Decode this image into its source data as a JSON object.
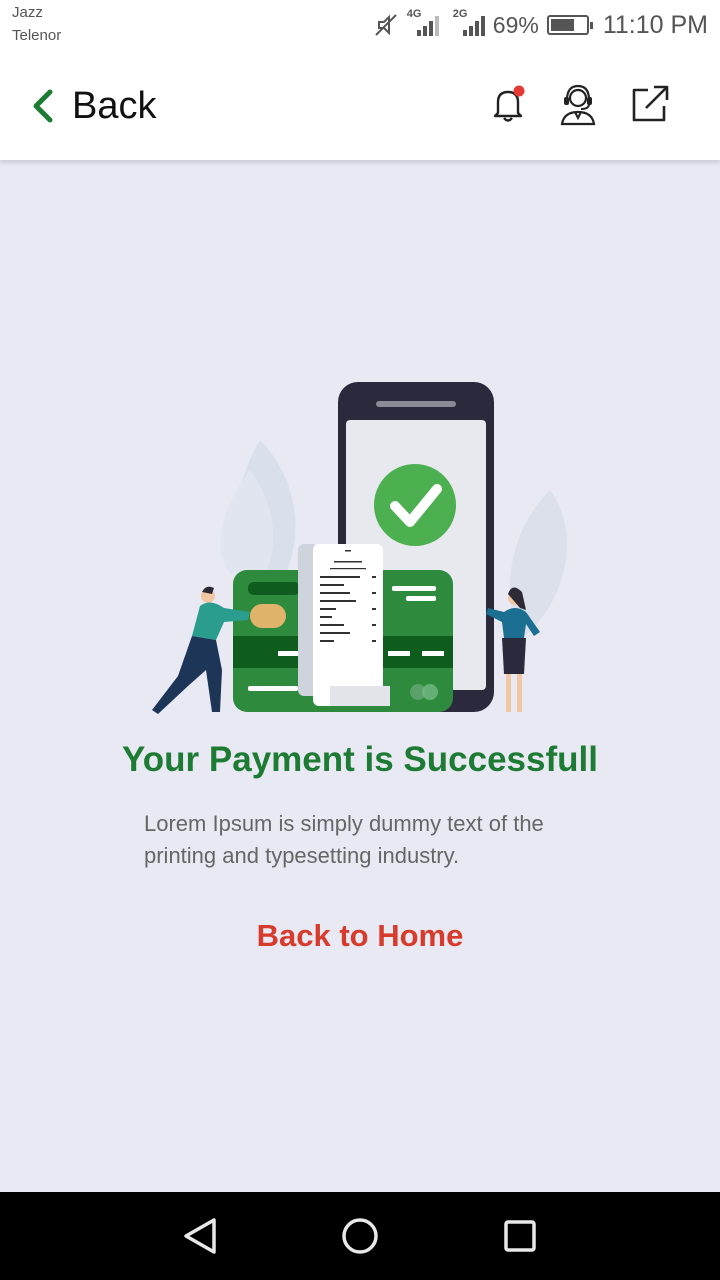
{
  "status_bar": {
    "carrier_1": "Jazz",
    "carrier_2": "Telenor",
    "network_1": "4G",
    "network_2": "2G",
    "battery_percent": "69%",
    "time": "11:10 PM",
    "icons": [
      "mute-icon",
      "signal-4g-icon",
      "signal-2g-icon",
      "battery-icon"
    ]
  },
  "app_bar": {
    "back_label": "Back",
    "icons": [
      "chevron-left-icon",
      "notification-bell-icon",
      "support-agent-icon",
      "share-external-icon"
    ],
    "accent": "#1e7b34",
    "notification_dot_color": "#e53935"
  },
  "main": {
    "title": "Your Payment is Successfull",
    "description": "Lorem Ipsum is simply dummy text of the printing and typesetting industry.",
    "home_link": "Back to Home",
    "title_color": "#1e7b34",
    "link_color": "#d63b2c"
  },
  "nav_bar": {
    "icons": [
      "nav-back-icon",
      "nav-home-icon",
      "nav-recents-icon"
    ]
  }
}
